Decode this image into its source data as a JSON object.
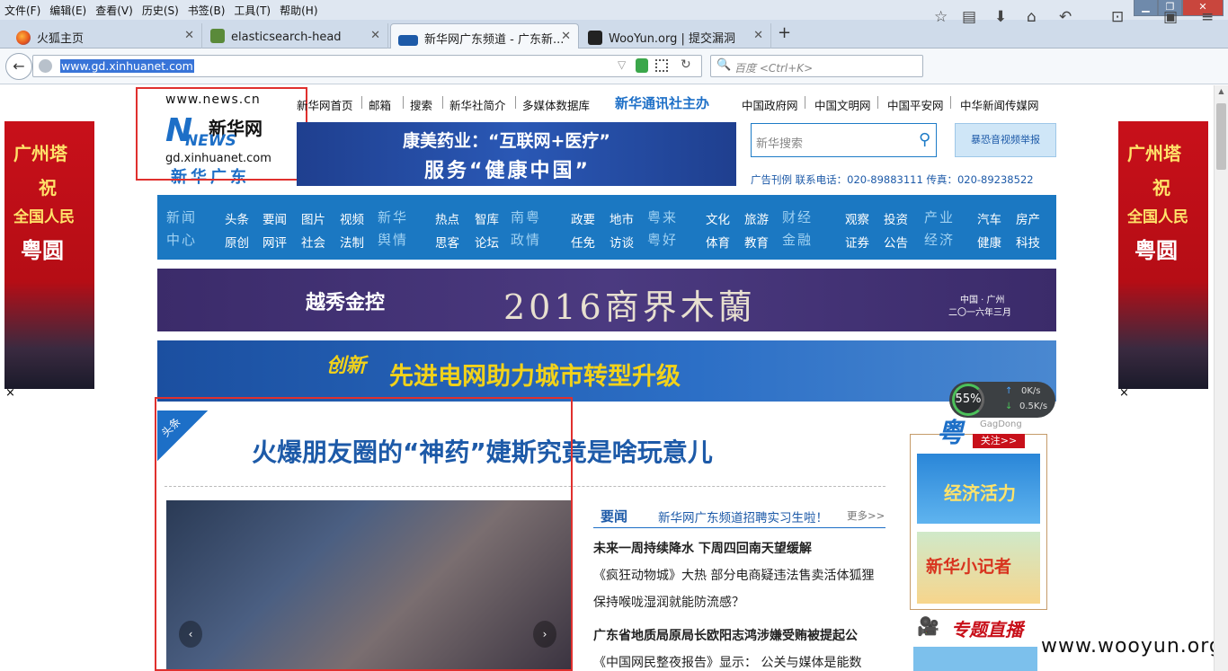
{
  "menu": [
    "文件(F)",
    "编辑(E)",
    "查看(V)",
    "历史(S)",
    "书签(B)",
    "工具(T)",
    "帮助(H)"
  ],
  "tabs": [
    {
      "label": "火狐主页"
    },
    {
      "label": "elasticsearch-head"
    },
    {
      "label": "新华网广东频道 - 广东新..."
    },
    {
      "label": "WooYun.org | 提交漏洞"
    }
  ],
  "new_tab_symbol": "+",
  "url": "www.gd.xinhuanet.com",
  "search_placeholder": "百度 <Ctrl+K>",
  "site": {
    "logo_top": "www.news.cn",
    "logo_brand": "新华网",
    "logo_news": "NEWS",
    "logo_domain": "gd.xinhuanet.com",
    "logo_sub": "新华广东",
    "topnav": [
      "新华网首页",
      "邮箱",
      "搜索",
      "新华社简介",
      "多媒体数据库"
    ],
    "host": "新华通讯社主办",
    "topnav_right": [
      "中国政府网",
      "中国文明网",
      "中国平安网",
      "中华新闻传媒网"
    ],
    "ad_banner_line1": "康美药业：“互联网+医疗”",
    "ad_banner_line2": "服务“健康中国”",
    "search_placeholder": "新华搜索",
    "report_btn": "暴恐音视频举报",
    "contact": "广告刊例  联系电话：020-89883111  传真：020-89238522",
    "nav_groups": [
      {
        "cat": "新闻中心",
        "items": [
          "头条",
          "要闻",
          "图片",
          "视频",
          "原创",
          "网评",
          "社会",
          "法制"
        ]
      },
      {
        "cat": "新华舆情",
        "items": []
      },
      {
        "cat": "",
        "items": [
          "热点",
          "智库",
          "思客",
          "论坛"
        ]
      },
      {
        "cat": "南粤政情",
        "items": []
      },
      {
        "cat": "",
        "items": [
          "政要",
          "地市",
          "任免",
          "访谈"
        ]
      },
      {
        "cat": "粤来粤好",
        "items": []
      },
      {
        "cat": "",
        "items": [
          "文化",
          "旅游",
          "体育",
          "教育"
        ]
      },
      {
        "cat": "财经金融",
        "items": []
      },
      {
        "cat": "",
        "items": [
          "观察",
          "投资",
          "证券",
          "公告"
        ]
      },
      {
        "cat": "产业经济",
        "items": []
      },
      {
        "cat": "",
        "items": [
          "汽车",
          "房产",
          "健康",
          "科技"
        ]
      }
    ],
    "banner_mulan": "2016商界木蘭",
    "banner_mulan_loc1": "中国 · 广州",
    "banner_mulan_loc2": "二〇一六年三月",
    "banner_mulan_brand": "越秀金控",
    "banner_grid": "先进电网助力城市转型升级",
    "banner_grid_lead": "创新",
    "left_ad": [
      "广州塔",
      "祝",
      "全国人民",
      "粤圆"
    ],
    "right_ad": [
      "广州塔",
      "祝",
      "全国人民",
      "粤圆"
    ],
    "ad_close": "×",
    "headline_tag": "头条",
    "headline": "火爆朋友圈的“神药”婕斯究竟是啥玩意儿",
    "news_tab": "要闻",
    "news_tab_link": "新华网广东频道招聘实习生啦！",
    "more": "更多>>",
    "news": [
      {
        "text": "未来一周持续降水  下周四回南天望缓解",
        "bold": true
      },
      {
        "text": "《疯狂动物城》大热  部分电商疑违法售卖活体狐狸",
        "bold": false
      },
      {
        "text": "保持喉咙湿润就能防流感？",
        "bold": false
      },
      {
        "text": "广东省地质局原局长欧阳志鸿涉嫌受贿被提起公",
        "bold": true
      },
      {
        "text": "《中国网民整夜报告》显示：  公关与媒体是能数",
        "bold": false
      }
    ],
    "side_logo": "粤",
    "side_follow": "关注>>",
    "side_ad1": "经济活力",
    "side_ad2": "新华小记者",
    "side_topic": "专题直播",
    "watermark": "www.wooyun.org"
  },
  "speed_widget": {
    "percent": "55%",
    "up": "0K/s",
    "down": "0.5K/s",
    "label": "GagDong"
  }
}
